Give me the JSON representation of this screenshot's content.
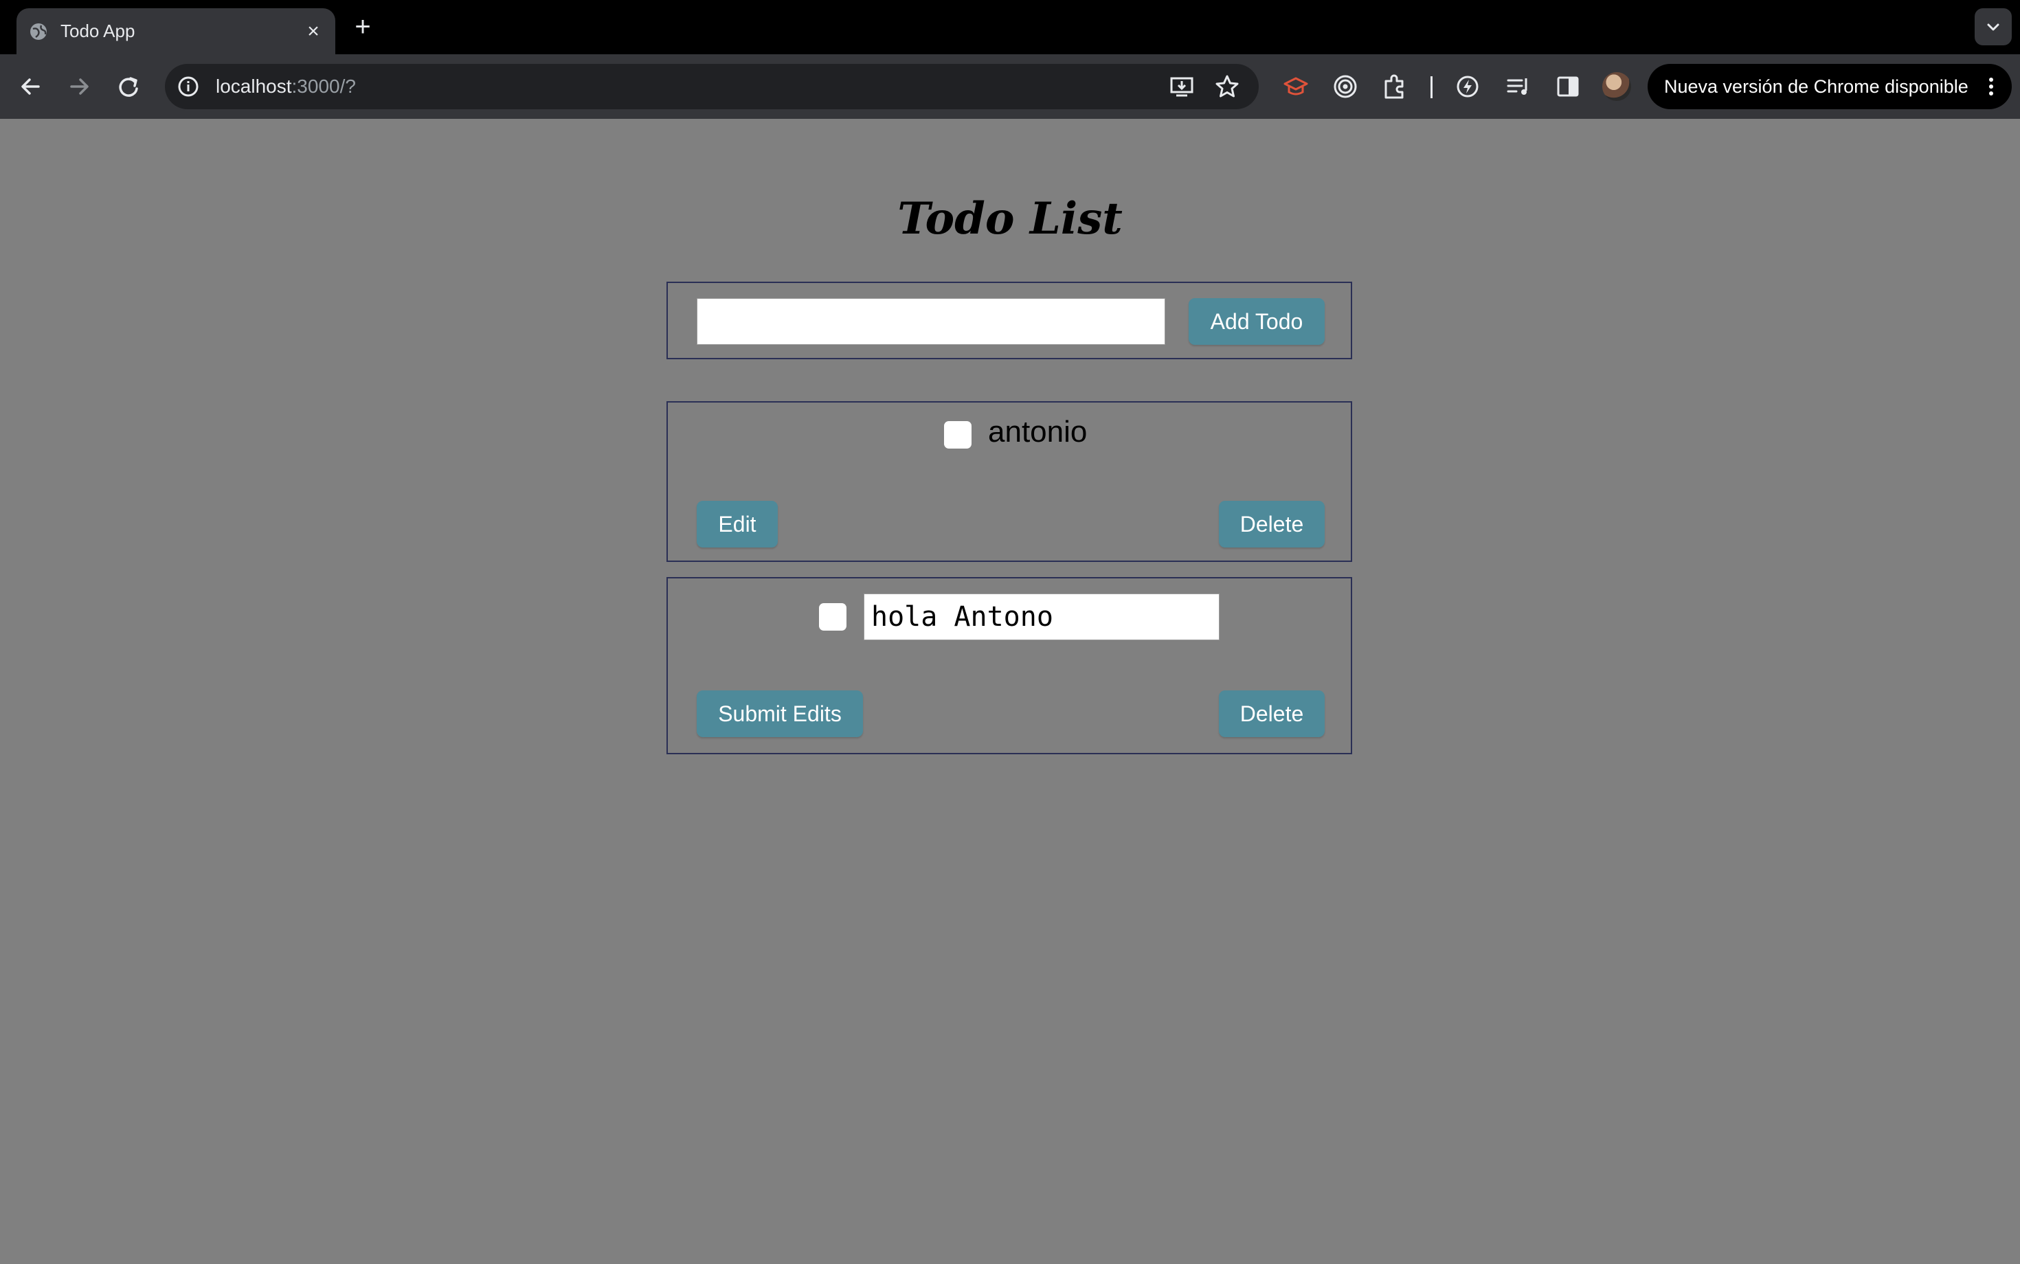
{
  "browser": {
    "tab_title": "Todo App",
    "tab_close": "×",
    "new_tab": "+",
    "url_host": "localhost",
    "url_rest": ":3000/?",
    "update_label": "Nueva versión de Chrome disponible"
  },
  "app": {
    "title": "Todo List",
    "new_todo_value": "",
    "add_button": "Add Todo",
    "todos": [
      {
        "text": "antonio",
        "done": false,
        "editing": false,
        "primary_button": "Edit",
        "delete_button": "Delete"
      },
      {
        "text": "hola Antono",
        "done": false,
        "editing": true,
        "primary_button": "Submit Edits",
        "delete_button": "Delete"
      }
    ]
  },
  "colors": {
    "page_background": "#808080",
    "button_background": "#4e8a9a",
    "box_border": "#2a2f55"
  }
}
